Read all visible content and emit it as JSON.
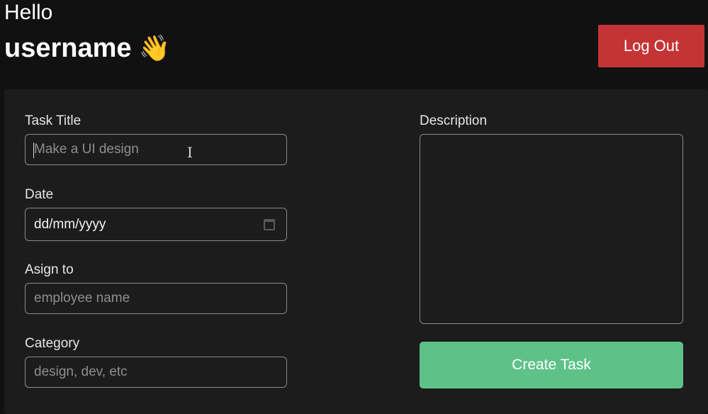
{
  "header": {
    "greeting": "Hello",
    "username": "username",
    "wave_emoji": "👋",
    "logout_label": "Log Out"
  },
  "form": {
    "task_title": {
      "label": "Task Title",
      "placeholder": "Make a UI design"
    },
    "date": {
      "label": "Date",
      "value": "dd/mm/yyyy"
    },
    "assign_to": {
      "label": "Asign to",
      "placeholder": "employee name"
    },
    "category": {
      "label": "Category",
      "placeholder": "design, dev, etc"
    },
    "description": {
      "label": "Description"
    },
    "create_label": "Create Task"
  },
  "colors": {
    "background": "#111111",
    "panel": "#1c1c1c",
    "logout_button": "#c53434",
    "create_button": "#5ec288",
    "field_border": "#8a8a8a"
  },
  "icons": {
    "wave": "waving-hand-icon",
    "calendar": "calendar-icon",
    "text_cursor": "text-cursor-icon"
  }
}
